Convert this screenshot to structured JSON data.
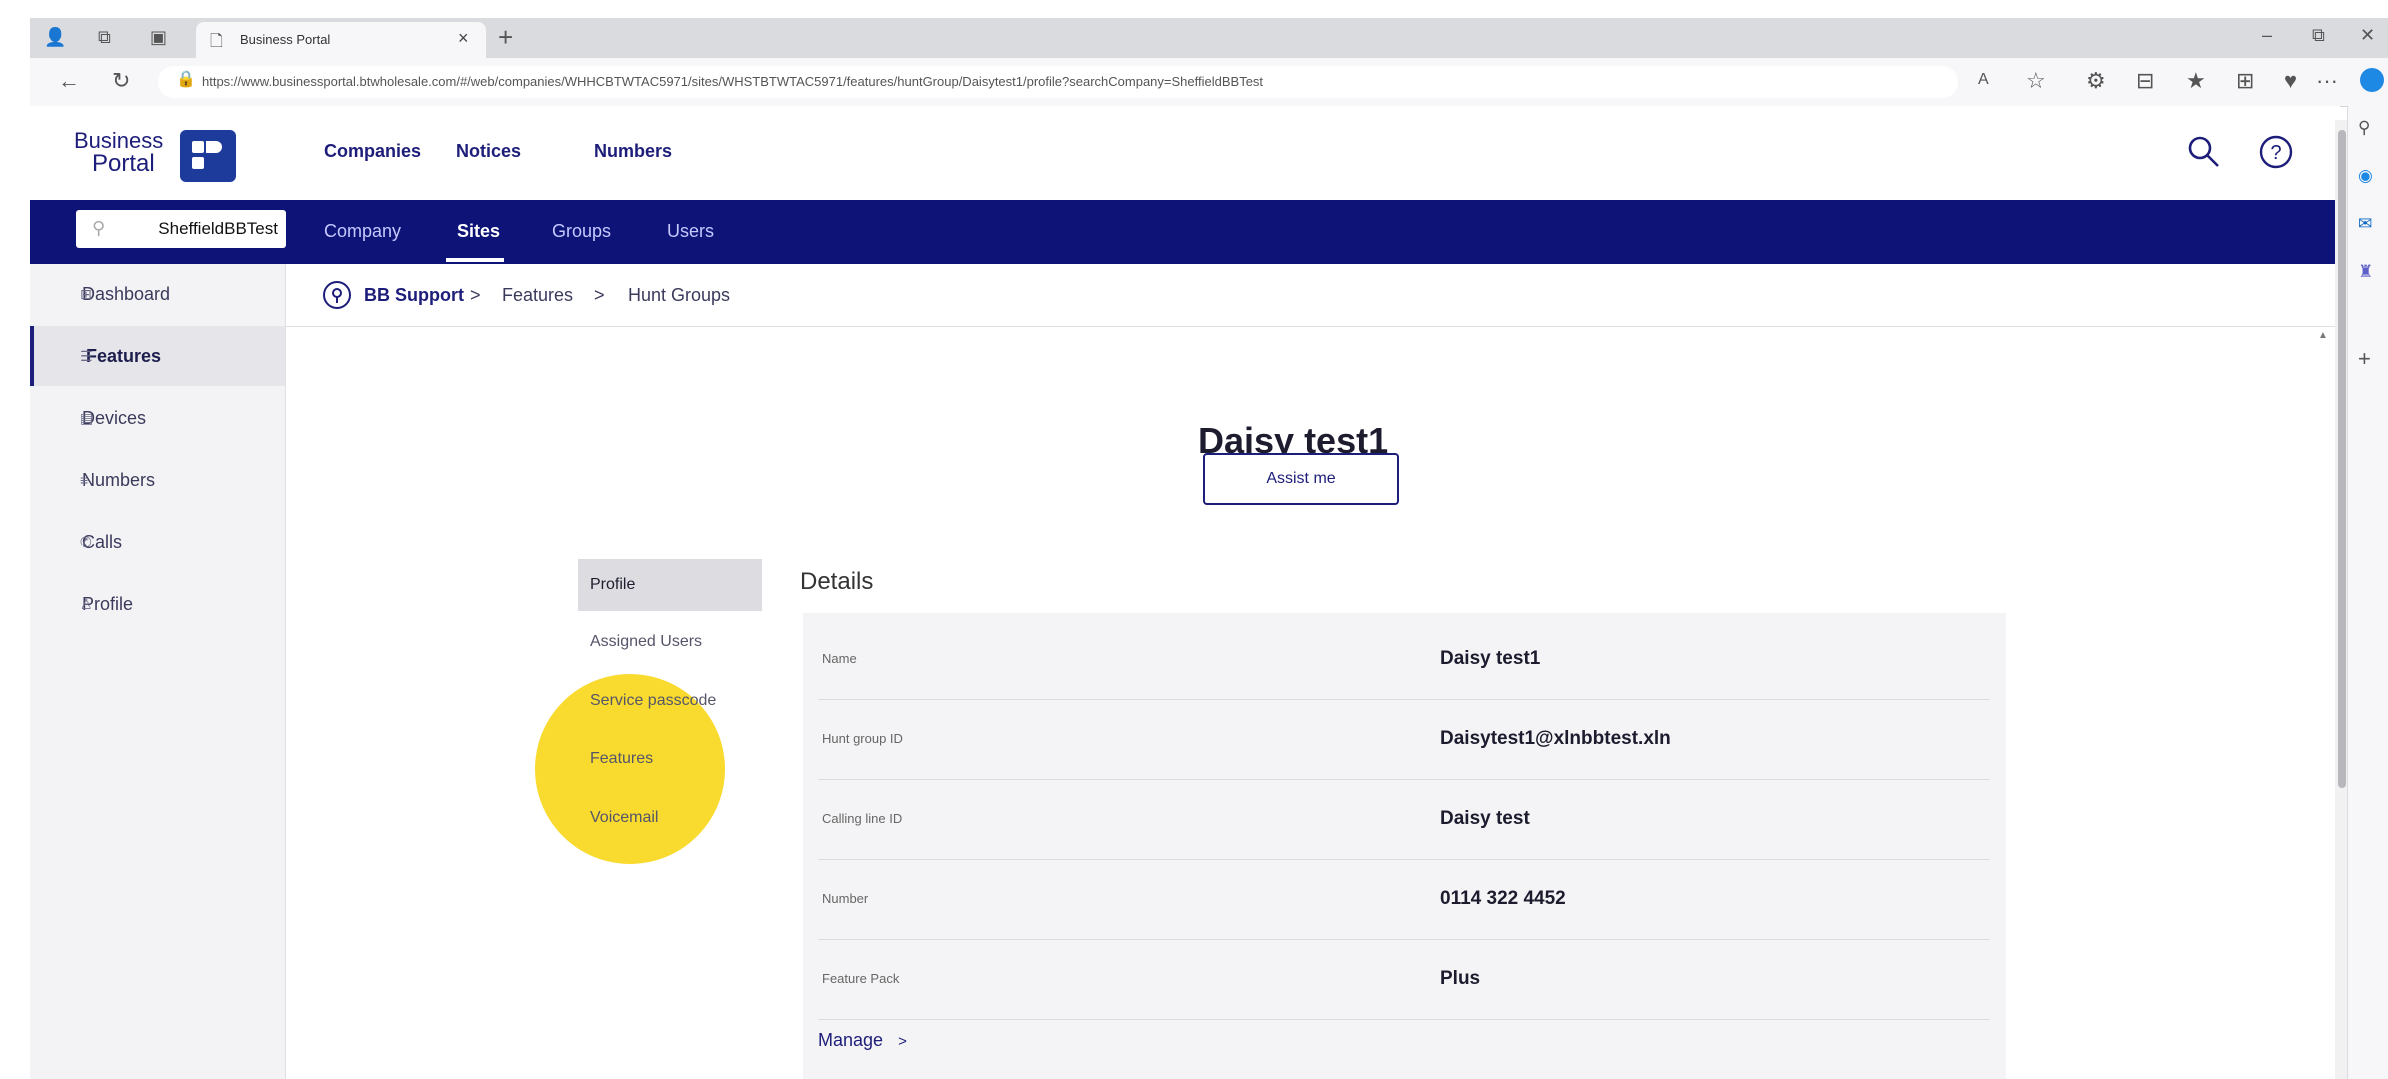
{
  "browser": {
    "tab_title": "Business Portal",
    "tab_close": "×",
    "new_tab": "+",
    "url": "https://www.businessportal.btwholesale.com/#/web/companies/WHHCBTWTAC5971/sites/WHSTBTWTAC5971/features/huntGroup/Daisytest1/profile?searchCompany=SheffieldBBTest",
    "back_icon": "arrow-left-icon",
    "refresh_icon": "refresh-icon",
    "window_minimize": "–",
    "window_maximize": "⧉",
    "window_close": "✕",
    "more": "···"
  },
  "header": {
    "logo_line1": "Business",
    "logo_line2": "Portal",
    "nav": [
      "Companies",
      "Notices",
      "Numbers"
    ],
    "search_icon": "search-icon",
    "help_icon": "help-icon"
  },
  "subnav": {
    "search_value": "SheffieldBBTest",
    "items": [
      "Company",
      "Sites",
      "Groups",
      "Users"
    ],
    "active": "Sites"
  },
  "sidebar": {
    "items": [
      {
        "label": "Dashboard",
        "icon": "dashboard-icon"
      },
      {
        "label": "Features",
        "icon": "features-icon"
      },
      {
        "label": "Devices",
        "icon": "devices-icon"
      },
      {
        "label": "Numbers",
        "icon": "numbers-icon"
      },
      {
        "label": "Calls",
        "icon": "calls-icon"
      },
      {
        "label": "Profile",
        "icon": "profile-icon"
      }
    ],
    "active": "Features"
  },
  "breadcrumb": {
    "site": "BB Support",
    "sep": ">",
    "items": [
      "Features",
      "Hunt Groups"
    ]
  },
  "main": {
    "title": "Daisy test1",
    "assist_label": "Assist me",
    "submenu": [
      "Profile",
      "Assigned Users",
      "Service passcode",
      "Features",
      "Voicemail"
    ],
    "submenu_active": "Profile",
    "details_heading": "Details",
    "details": [
      {
        "label": "Name",
        "value": "Daisy test1"
      },
      {
        "label": "Hunt group ID",
        "value": "Daisytest1@xlnbbtest.xln"
      },
      {
        "label": "Calling line ID",
        "value": "Daisy test"
      },
      {
        "label": "Number",
        "value": "0114 322 4452"
      },
      {
        "label": "Feature Pack",
        "value": "Plus"
      }
    ],
    "manage_label": "Manage",
    "manage_chevron": ">"
  },
  "colors": {
    "navy": "#0d1377",
    "brand_text": "#1d1d7a",
    "highlight": "#f9d71c"
  }
}
